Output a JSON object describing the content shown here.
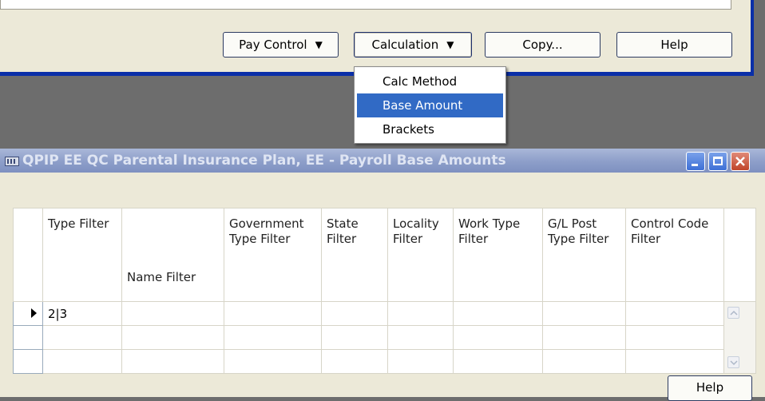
{
  "top_window": {
    "buttons": {
      "pay_control": "Pay Control",
      "calculation": "Calculation",
      "copy": "Copy...",
      "help": "Help"
    }
  },
  "calculation_menu": {
    "items": [
      {
        "label": "Calc Method",
        "selected": false
      },
      {
        "label": "Base Amount",
        "selected": true
      },
      {
        "label": "Brackets",
        "selected": false
      }
    ]
  },
  "window": {
    "title": "QPIP EE QC Parental Insurance Plan, EE - Payroll Base Amounts",
    "grid": {
      "columns": [
        "Type Filter",
        "Name Filter",
        "Government Type Filter",
        "State Filter",
        "Locality Filter",
        "Work Type Filter",
        "G/L Post Type Filter",
        "Control Code Filter"
      ],
      "rows": [
        [
          "2|3",
          "",
          "",
          "",
          "",
          "",
          "",
          ""
        ],
        [
          "",
          "",
          "",
          "",
          "",
          "",
          "",
          ""
        ],
        [
          "",
          "",
          "",
          "",
          "",
          "",
          "",
          ""
        ]
      ]
    },
    "help_button": "Help"
  },
  "colors": {
    "selection": "#316ac5",
    "window_border": "#0a2fa8",
    "face": "#ece9d8"
  }
}
